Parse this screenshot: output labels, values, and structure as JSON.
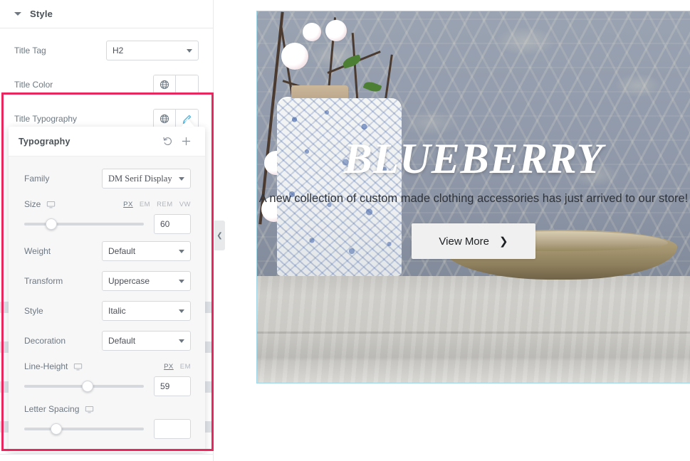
{
  "panel": {
    "section": {
      "title": "Style",
      "caret_icon": "caret-down-icon"
    },
    "rows": [
      {
        "label": "Title Tag",
        "control": "select",
        "value": "H2"
      },
      {
        "label": "Title Color",
        "control": "color",
        "globe_icon": "globe-icon"
      },
      {
        "label": "Title Typography",
        "control": "typography",
        "globe_icon": "globe-icon",
        "edit_icon": "pencil-icon"
      }
    ]
  },
  "typography_popover": {
    "title": "Typography",
    "reset_icon": "reset-icon",
    "reset_glyph": "↺",
    "add_icon": "plus-icon",
    "add_glyph": "+",
    "family": {
      "label": "Family",
      "value": "DM Serif Display"
    },
    "size": {
      "label": "Size",
      "responsive_icon": "monitor-icon",
      "units": [
        "PX",
        "EM",
        "REM",
        "VW"
      ],
      "active_unit": "PX",
      "value": "60",
      "slider_percent": 18
    },
    "weight": {
      "label": "Weight",
      "value": "Default"
    },
    "transform": {
      "label": "Transform",
      "value": "Uppercase"
    },
    "style": {
      "label": "Style",
      "value": "Italic"
    },
    "decoration": {
      "label": "Decoration",
      "value": "Default"
    },
    "line_height": {
      "label": "Line-Height",
      "responsive_icon": "monitor-icon",
      "units": [
        "PX",
        "EM"
      ],
      "active_unit": "PX",
      "value": "59",
      "slider_percent": 48
    },
    "letter_spacing": {
      "label": "Letter Spacing",
      "responsive_icon": "monitor-icon",
      "value": "",
      "slider_percent": 22
    }
  },
  "highlight": {
    "color": "#e8275e"
  },
  "collapse_handle": {
    "icon": "chevron-left-icon",
    "glyph": "❮"
  },
  "preview": {
    "hero": {
      "title": "Blueberry",
      "subtitle": "A new collection of custom made clothing accessories has just arrived to our store!",
      "button_label": "View More",
      "button_chevron": "❯",
      "selection_color": "#9fd7e8"
    }
  }
}
